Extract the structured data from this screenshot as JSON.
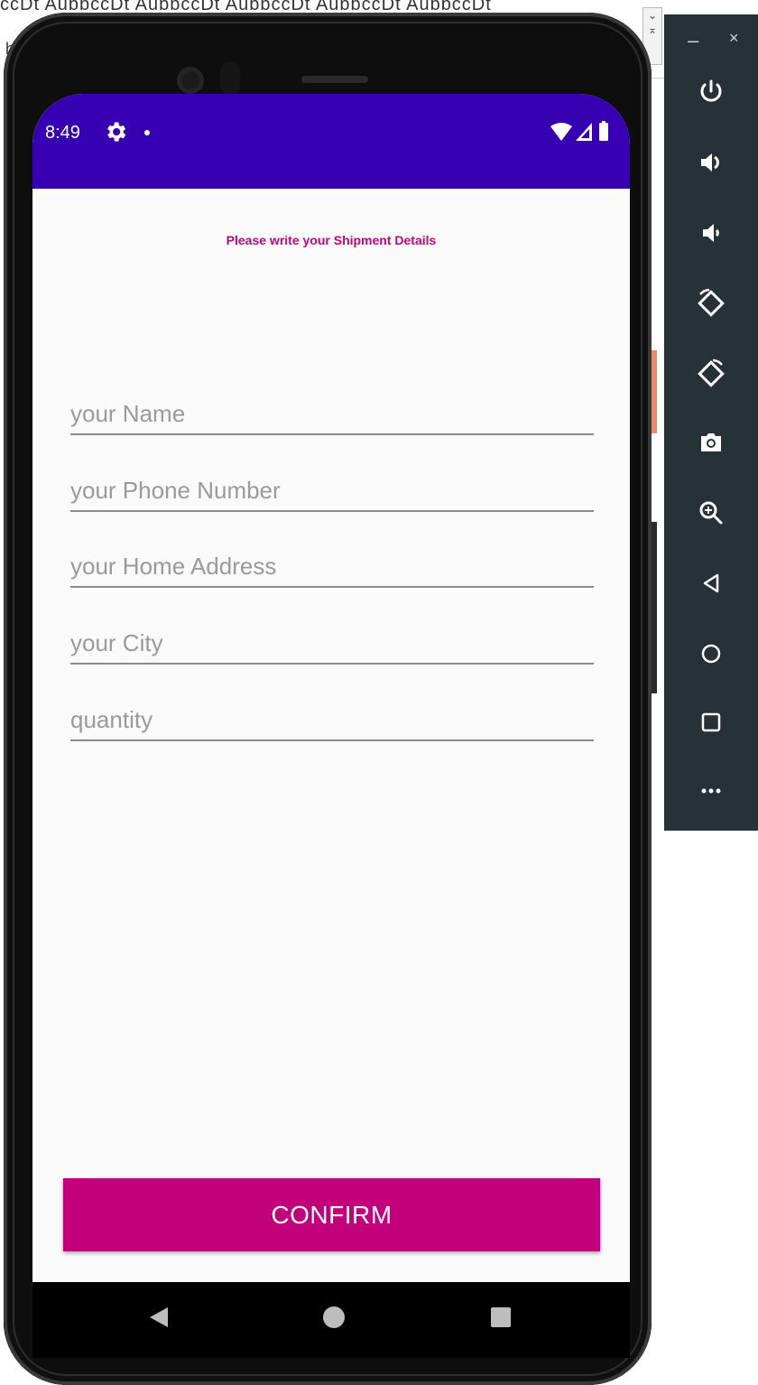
{
  "host": {
    "text_row": "ccDt AubbccDt AubbccDt AubbccDt AubbccDt AubbccDt",
    "text_row2": "ha"
  },
  "status_bar": {
    "time": "8:49",
    "icons": [
      "gear-icon",
      "notification-dot",
      "wifi-icon",
      "signal-icon",
      "battery-icon"
    ],
    "color": "#3700b3"
  },
  "screen": {
    "headline": "Please write your Shipment Details",
    "fields": [
      {
        "name": "name",
        "placeholder": "your Name",
        "value": ""
      },
      {
        "name": "phone",
        "placeholder": "your Phone Number",
        "value": ""
      },
      {
        "name": "address",
        "placeholder": "your Home Address",
        "value": ""
      },
      {
        "name": "city",
        "placeholder": "your City",
        "value": ""
      },
      {
        "name": "quantity",
        "placeholder": "quantity",
        "value": ""
      }
    ],
    "confirm_label": "CONFIRM",
    "accent": "#c2007a"
  },
  "navbar": {
    "icons": [
      "back-triangle-icon",
      "home-circle-icon",
      "recents-square-icon"
    ]
  },
  "emulator_toolbar": {
    "minimize": "–",
    "close": "×",
    "buttons": [
      "power-icon",
      "volume-up-icon",
      "volume-down-icon",
      "rotate-left-icon",
      "rotate-right-icon",
      "camera-icon",
      "zoom-icon",
      "back-icon",
      "home-icon",
      "overview-icon",
      "more-icon"
    ]
  }
}
